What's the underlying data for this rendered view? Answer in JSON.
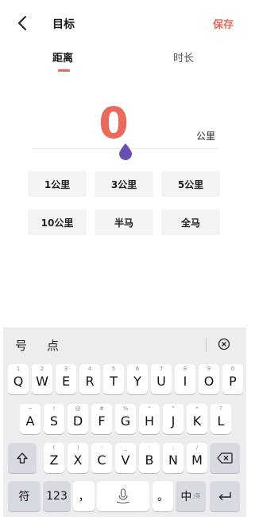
{
  "header": {
    "title": "目标",
    "save_label": "保存"
  },
  "tabs": {
    "distance": "距离",
    "duration": "时长"
  },
  "goal": {
    "value": "0",
    "unit": "公里"
  },
  "presets": [
    "1公里",
    "3公里",
    "5公里",
    "10公里",
    "半马",
    "全马"
  ],
  "keyboard": {
    "candidates": [
      "号",
      "点"
    ],
    "row1": [
      {
        "hint": "1",
        "ch": "Q"
      },
      {
        "hint": "2",
        "ch": "W"
      },
      {
        "hint": "3",
        "ch": "E"
      },
      {
        "hint": "4",
        "ch": "R"
      },
      {
        "hint": "5",
        "ch": "T"
      },
      {
        "hint": "6",
        "ch": "Y"
      },
      {
        "hint": "7",
        "ch": "U"
      },
      {
        "hint": "8",
        "ch": "I"
      },
      {
        "hint": "9",
        "ch": "O"
      },
      {
        "hint": "0",
        "ch": "P"
      }
    ],
    "row2": [
      {
        "hint": "~",
        "ch": "A"
      },
      {
        "hint": "!",
        "ch": "S"
      },
      {
        "hint": "@",
        "ch": "D"
      },
      {
        "hint": "#",
        "ch": "F"
      },
      {
        "hint": "%",
        "ch": "G"
      },
      {
        "hint": "“",
        "ch": "H"
      },
      {
        "hint": "”",
        "ch": "J"
      },
      {
        "hint": "*",
        "ch": "K"
      },
      {
        "hint": "?",
        "ch": "L"
      }
    ],
    "row3": [
      {
        "hint": "(",
        "ch": "Z"
      },
      {
        "hint": ")",
        "ch": "X"
      },
      {
        "hint": "-",
        "ch": "C"
      },
      {
        "hint": "_",
        "ch": "V"
      },
      {
        "hint": ":",
        "ch": "B"
      },
      {
        "hint": ";",
        "ch": "N"
      },
      {
        "hint": "/",
        "ch": "M"
      }
    ],
    "symbols_label": "符",
    "numbers_label": "123",
    "comma_label": "，",
    "period_label": "。",
    "lang_label": "中",
    "lang_sub": "/英"
  },
  "colors": {
    "accent": "#e96a5c",
    "knob": "#6a4fb0"
  }
}
